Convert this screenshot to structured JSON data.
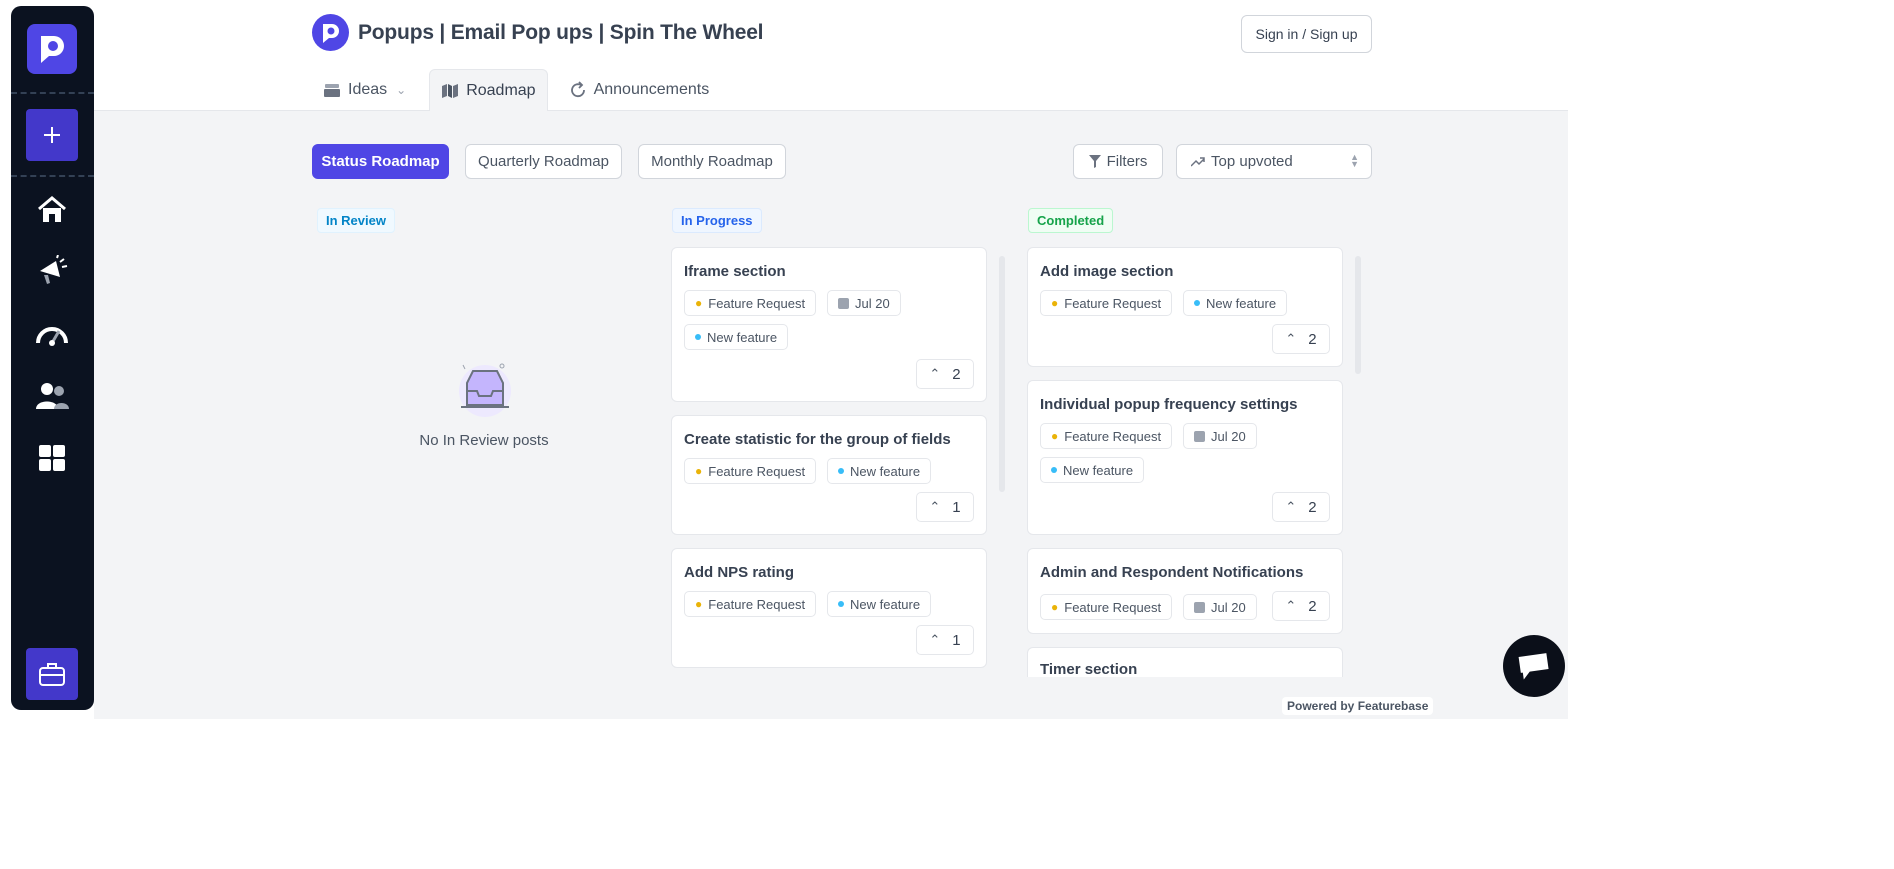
{
  "header": {
    "title": "Popups | Email Pop ups | Spin The Wheel",
    "signin_label": "Sign in / Sign up",
    "tabs": [
      {
        "label": "Ideas"
      },
      {
        "label": "Roadmap"
      },
      {
        "label": "Announcements"
      }
    ]
  },
  "toolbar": {
    "views": [
      "Status Roadmap",
      "Quarterly Roadmap",
      "Monthly Roadmap"
    ],
    "filters_label": "Filters",
    "sort_value": "Top upvoted"
  },
  "columns": [
    {
      "label": "In Review",
      "empty_text": "No In Review posts"
    },
    {
      "label": "In Progress",
      "cards": [
        {
          "title": "Iframe section",
          "tags": [
            "Feature Request",
            "Jul 20",
            "New feature"
          ],
          "votes": "2"
        },
        {
          "title": "Create statistic for the group of fields",
          "tags": [
            "Feature Request",
            "New feature"
          ],
          "votes": "1"
        },
        {
          "title": "Add NPS rating",
          "tags": [
            "Feature Request",
            "New feature"
          ],
          "votes": "1"
        }
      ]
    },
    {
      "label": "Completed",
      "cards": [
        {
          "title": "Add image section",
          "tags": [
            "Feature Request",
            "New feature"
          ],
          "votes": "2"
        },
        {
          "title": "Individual popup frequency settings",
          "tags": [
            "Feature Request",
            "Jul 20",
            "New feature"
          ],
          "votes": "2"
        },
        {
          "title": "Admin and Respondent Notifications",
          "tags": [
            "Feature Request",
            "Jul 20"
          ],
          "votes": "2"
        },
        {
          "title": "Timer section"
        }
      ]
    }
  ],
  "footer": {
    "powered_by": "Powered by Featurebase"
  },
  "colors": {
    "accent": "#4f46e5",
    "rail_bg": "#0b1220",
    "in_review": "#0284c7",
    "in_progress": "#2563eb",
    "completed": "#16a34a"
  }
}
